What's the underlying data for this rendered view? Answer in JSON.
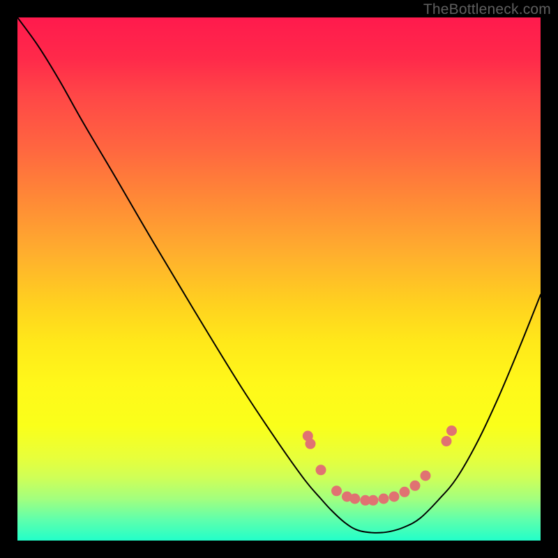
{
  "watermark": "TheBottleneck.com",
  "accent": {
    "marker_fill": "#e07272",
    "curve_stroke": "#000000"
  },
  "chart_data": {
    "type": "line",
    "title": "",
    "xlabel": "",
    "ylabel": "",
    "xlim": [
      0,
      100
    ],
    "ylim": [
      0,
      100
    ],
    "curve": [
      {
        "x": 0.0,
        "y": 100.0
      },
      {
        "x": 4.0,
        "y": 94.5
      },
      {
        "x": 8.0,
        "y": 88.0
      },
      {
        "x": 12.5,
        "y": 80.0
      },
      {
        "x": 19.0,
        "y": 69.0
      },
      {
        "x": 26.0,
        "y": 57.0
      },
      {
        "x": 35.0,
        "y": 42.0
      },
      {
        "x": 43.0,
        "y": 29.0
      },
      {
        "x": 50.0,
        "y": 18.5
      },
      {
        "x": 55.0,
        "y": 11.5
      },
      {
        "x": 58.0,
        "y": 8.0
      },
      {
        "x": 60.0,
        "y": 5.8
      },
      {
        "x": 62.5,
        "y": 3.5
      },
      {
        "x": 65.0,
        "y": 2.0
      },
      {
        "x": 68.0,
        "y": 1.5
      },
      {
        "x": 71.0,
        "y": 1.7
      },
      {
        "x": 74.0,
        "y": 2.6
      },
      {
        "x": 77.0,
        "y": 4.3
      },
      {
        "x": 80.5,
        "y": 7.8
      },
      {
        "x": 84.0,
        "y": 12.0
      },
      {
        "x": 88.0,
        "y": 19.0
      },
      {
        "x": 92.0,
        "y": 27.5
      },
      {
        "x": 96.0,
        "y": 37.0
      },
      {
        "x": 100.0,
        "y": 47.0
      }
    ],
    "markers": [
      {
        "x": 55.5,
        "y": 20.0
      },
      {
        "x": 56.0,
        "y": 18.5
      },
      {
        "x": 58.0,
        "y": 13.5
      },
      {
        "x": 61.0,
        "y": 9.5
      },
      {
        "x": 63.0,
        "y": 8.4
      },
      {
        "x": 64.5,
        "y": 8.0
      },
      {
        "x": 66.5,
        "y": 7.7
      },
      {
        "x": 68.0,
        "y": 7.7
      },
      {
        "x": 70.0,
        "y": 8.0
      },
      {
        "x": 72.0,
        "y": 8.4
      },
      {
        "x": 74.0,
        "y": 9.3
      },
      {
        "x": 76.0,
        "y": 10.5
      },
      {
        "x": 78.0,
        "y": 12.4
      },
      {
        "x": 82.0,
        "y": 19.0
      },
      {
        "x": 83.0,
        "y": 21.0
      }
    ]
  }
}
